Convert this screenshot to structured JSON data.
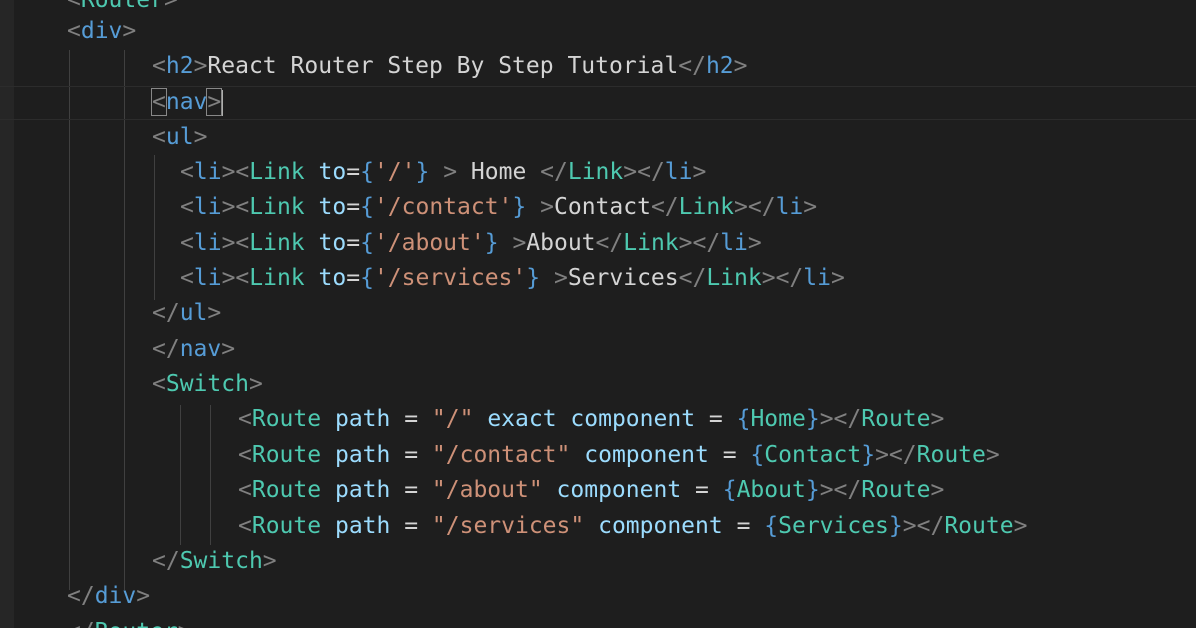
{
  "editor": {
    "lines": [
      {
        "id": "line-router-open",
        "tokens": [
          {
            "t": "punct",
            "v": "<"
          },
          {
            "t": "comp",
            "v": "Router"
          },
          {
            "t": "punct",
            "v": ">"
          }
        ]
      },
      {
        "id": "line-div-open",
        "tokens": [
          {
            "t": "punct",
            "v": "<"
          },
          {
            "t": "tag",
            "v": "div"
          },
          {
            "t": "punct",
            "v": ">"
          }
        ]
      },
      {
        "id": "line-h2",
        "tokens": [
          {
            "t": "punct",
            "v": "<"
          },
          {
            "t": "tag",
            "v": "h2"
          },
          {
            "t": "punct",
            "v": ">"
          },
          {
            "t": "txt",
            "v": "React Router Step By Step Tutorial"
          },
          {
            "t": "punct",
            "v": "</"
          },
          {
            "t": "tag",
            "v": "h2"
          },
          {
            "t": "punct",
            "v": ">"
          }
        ]
      },
      {
        "id": "line-nav-open",
        "tokens": [
          {
            "t": "punct",
            "v": "<",
            "box": true
          },
          {
            "t": "tag",
            "v": "nav"
          },
          {
            "t": "punct",
            "v": ">",
            "box": true
          }
        ],
        "cursor": true
      },
      {
        "id": "line-ul-open",
        "tokens": [
          {
            "t": "punct",
            "v": "<"
          },
          {
            "t": "tag",
            "v": "ul"
          },
          {
            "t": "punct",
            "v": ">"
          }
        ]
      },
      {
        "id": "line-li-home",
        "tokens": [
          {
            "t": "punct",
            "v": "<"
          },
          {
            "t": "tag",
            "v": "li"
          },
          {
            "t": "punct",
            "v": "><"
          },
          {
            "t": "comp",
            "v": "Link"
          },
          {
            "t": "txt",
            "v": " "
          },
          {
            "t": "attr",
            "v": "to"
          },
          {
            "t": "op",
            "v": "="
          },
          {
            "t": "brace",
            "v": "{"
          },
          {
            "t": "str",
            "v": "'/'"
          },
          {
            "t": "brace",
            "v": "}"
          },
          {
            "t": "txt",
            "v": " "
          },
          {
            "t": "punct",
            "v": ">"
          },
          {
            "t": "txt",
            "v": " Home "
          },
          {
            "t": "punct",
            "v": "</"
          },
          {
            "t": "comp",
            "v": "Link"
          },
          {
            "t": "punct",
            "v": "></"
          },
          {
            "t": "tag",
            "v": "li"
          },
          {
            "t": "punct",
            "v": ">"
          }
        ]
      },
      {
        "id": "line-li-contact",
        "tokens": [
          {
            "t": "punct",
            "v": "<"
          },
          {
            "t": "tag",
            "v": "li"
          },
          {
            "t": "punct",
            "v": "><"
          },
          {
            "t": "comp",
            "v": "Link"
          },
          {
            "t": "txt",
            "v": " "
          },
          {
            "t": "attr",
            "v": "to"
          },
          {
            "t": "op",
            "v": "="
          },
          {
            "t": "brace",
            "v": "{"
          },
          {
            "t": "str",
            "v": "'/contact'"
          },
          {
            "t": "brace",
            "v": "}"
          },
          {
            "t": "txt",
            "v": " "
          },
          {
            "t": "punct",
            "v": ">"
          },
          {
            "t": "txt",
            "v": "Contact"
          },
          {
            "t": "punct",
            "v": "</"
          },
          {
            "t": "comp",
            "v": "Link"
          },
          {
            "t": "punct",
            "v": "></"
          },
          {
            "t": "tag",
            "v": "li"
          },
          {
            "t": "punct",
            "v": ">"
          }
        ]
      },
      {
        "id": "line-li-about",
        "tokens": [
          {
            "t": "punct",
            "v": "<"
          },
          {
            "t": "tag",
            "v": "li"
          },
          {
            "t": "punct",
            "v": "><"
          },
          {
            "t": "comp",
            "v": "Link"
          },
          {
            "t": "txt",
            "v": " "
          },
          {
            "t": "attr",
            "v": "to"
          },
          {
            "t": "op",
            "v": "="
          },
          {
            "t": "brace",
            "v": "{"
          },
          {
            "t": "str",
            "v": "'/about'"
          },
          {
            "t": "brace",
            "v": "}"
          },
          {
            "t": "txt",
            "v": " "
          },
          {
            "t": "punct",
            "v": ">"
          },
          {
            "t": "txt",
            "v": "About"
          },
          {
            "t": "punct",
            "v": "</"
          },
          {
            "t": "comp",
            "v": "Link"
          },
          {
            "t": "punct",
            "v": "></"
          },
          {
            "t": "tag",
            "v": "li"
          },
          {
            "t": "punct",
            "v": ">"
          }
        ]
      },
      {
        "id": "line-li-services",
        "tokens": [
          {
            "t": "punct",
            "v": "<"
          },
          {
            "t": "tag",
            "v": "li"
          },
          {
            "t": "punct",
            "v": "><"
          },
          {
            "t": "comp",
            "v": "Link"
          },
          {
            "t": "txt",
            "v": " "
          },
          {
            "t": "attr",
            "v": "to"
          },
          {
            "t": "op",
            "v": "="
          },
          {
            "t": "brace",
            "v": "{"
          },
          {
            "t": "str",
            "v": "'/services'"
          },
          {
            "t": "brace",
            "v": "}"
          },
          {
            "t": "txt",
            "v": " "
          },
          {
            "t": "punct",
            "v": ">"
          },
          {
            "t": "txt",
            "v": "Services"
          },
          {
            "t": "punct",
            "v": "</"
          },
          {
            "t": "comp",
            "v": "Link"
          },
          {
            "t": "punct",
            "v": "></"
          },
          {
            "t": "tag",
            "v": "li"
          },
          {
            "t": "punct",
            "v": ">"
          }
        ]
      },
      {
        "id": "line-ul-close",
        "tokens": [
          {
            "t": "punct",
            "v": "</"
          },
          {
            "t": "tag",
            "v": "ul"
          },
          {
            "t": "punct",
            "v": ">"
          }
        ]
      },
      {
        "id": "line-nav-close",
        "tokens": [
          {
            "t": "punct",
            "v": "</"
          },
          {
            "t": "tag",
            "v": "nav"
          },
          {
            "t": "punct",
            "v": ">"
          }
        ]
      },
      {
        "id": "line-switch-open",
        "tokens": [
          {
            "t": "punct",
            "v": "<"
          },
          {
            "t": "comp",
            "v": "Switch"
          },
          {
            "t": "punct",
            "v": ">"
          }
        ]
      },
      {
        "id": "line-route-home",
        "tokens": [
          {
            "t": "punct",
            "v": "<"
          },
          {
            "t": "comp",
            "v": "Route"
          },
          {
            "t": "txt",
            "v": " "
          },
          {
            "t": "attr",
            "v": "path"
          },
          {
            "t": "op",
            "v": " = "
          },
          {
            "t": "str",
            "v": "\"/\""
          },
          {
            "t": "txt",
            "v": " "
          },
          {
            "t": "attr",
            "v": "exact"
          },
          {
            "t": "txt",
            "v": " "
          },
          {
            "t": "attr",
            "v": "component"
          },
          {
            "t": "op",
            "v": " = "
          },
          {
            "t": "brace",
            "v": "{"
          },
          {
            "t": "comp",
            "v": "Home"
          },
          {
            "t": "brace",
            "v": "}"
          },
          {
            "t": "punct",
            "v": "></"
          },
          {
            "t": "comp",
            "v": "Route"
          },
          {
            "t": "punct",
            "v": ">"
          }
        ]
      },
      {
        "id": "line-route-contact",
        "tokens": [
          {
            "t": "punct",
            "v": "<"
          },
          {
            "t": "comp",
            "v": "Route"
          },
          {
            "t": "txt",
            "v": " "
          },
          {
            "t": "attr",
            "v": "path"
          },
          {
            "t": "op",
            "v": " = "
          },
          {
            "t": "str",
            "v": "\"/contact\""
          },
          {
            "t": "txt",
            "v": " "
          },
          {
            "t": "attr",
            "v": "component"
          },
          {
            "t": "op",
            "v": " = "
          },
          {
            "t": "brace",
            "v": "{"
          },
          {
            "t": "comp",
            "v": "Contact"
          },
          {
            "t": "brace",
            "v": "}"
          },
          {
            "t": "punct",
            "v": "></"
          },
          {
            "t": "comp",
            "v": "Route"
          },
          {
            "t": "punct",
            "v": ">"
          }
        ]
      },
      {
        "id": "line-route-about",
        "tokens": [
          {
            "t": "punct",
            "v": "<"
          },
          {
            "t": "comp",
            "v": "Route"
          },
          {
            "t": "txt",
            "v": " "
          },
          {
            "t": "attr",
            "v": "path"
          },
          {
            "t": "op",
            "v": " = "
          },
          {
            "t": "str",
            "v": "\"/about\""
          },
          {
            "t": "txt",
            "v": " "
          },
          {
            "t": "attr",
            "v": "component"
          },
          {
            "t": "op",
            "v": " = "
          },
          {
            "t": "brace",
            "v": "{"
          },
          {
            "t": "comp",
            "v": "About"
          },
          {
            "t": "brace",
            "v": "}"
          },
          {
            "t": "punct",
            "v": "></"
          },
          {
            "t": "comp",
            "v": "Route"
          },
          {
            "t": "punct",
            "v": ">"
          }
        ]
      },
      {
        "id": "line-route-services",
        "tokens": [
          {
            "t": "punct",
            "v": "<"
          },
          {
            "t": "comp",
            "v": "Route"
          },
          {
            "t": "txt",
            "v": " "
          },
          {
            "t": "attr",
            "v": "path"
          },
          {
            "t": "op",
            "v": " = "
          },
          {
            "t": "str",
            "v": "\"/services\""
          },
          {
            "t": "txt",
            "v": " "
          },
          {
            "t": "attr",
            "v": "component"
          },
          {
            "t": "op",
            "v": " = "
          },
          {
            "t": "brace",
            "v": "{"
          },
          {
            "t": "comp",
            "v": "Services"
          },
          {
            "t": "brace",
            "v": "}"
          },
          {
            "t": "punct",
            "v": "></"
          },
          {
            "t": "comp",
            "v": "Route"
          },
          {
            "t": "punct",
            "v": ">"
          }
        ]
      },
      {
        "id": "line-switch-close",
        "tokens": [
          {
            "t": "punct",
            "v": "</"
          },
          {
            "t": "comp",
            "v": "Switch"
          },
          {
            "t": "punct",
            "v": ">"
          }
        ]
      },
      {
        "id": "line-div-close",
        "tokens": [
          {
            "t": "punct",
            "v": "</"
          },
          {
            "t": "tag",
            "v": "div"
          },
          {
            "t": "punct",
            "v": ">"
          }
        ]
      },
      {
        "id": "line-router-close",
        "tokens": [
          {
            "t": "punct",
            "v": "</"
          },
          {
            "t": "comp",
            "v": "Router"
          },
          {
            "t": "punct",
            "v": ">"
          }
        ]
      }
    ]
  },
  "colors": {
    "background": "#1e1e1e",
    "punctuation": "#808080",
    "html_tag": "#569cd6",
    "component": "#4ec9b0",
    "attribute": "#9cdcfe",
    "string": "#ce9178",
    "text": "#d4d4d4"
  }
}
